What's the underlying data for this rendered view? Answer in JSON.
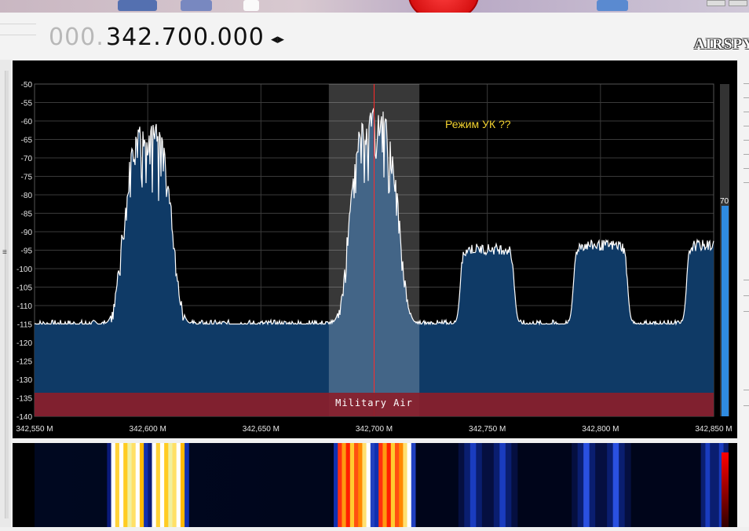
{
  "frequency": {
    "dim_prefix": "000.",
    "main": "342.700.000",
    "step_arrows": "◂▸"
  },
  "brand": {
    "logo_text": "AIRSPY"
  },
  "colors": {
    "spectrum_fill": "#0f3a66",
    "spectrum_line": "#ffffff",
    "band_plan": "#8a1e2a",
    "filter_overlay": "#ffffff",
    "center_line": "#ff2a2a",
    "annotation": "#f2d230",
    "signal_meter": "#2f8be0"
  },
  "chart_data": {
    "type": "area",
    "title": "",
    "xlabel": "",
    "ylabel": "",
    "x_range": [
      342550000,
      342850000
    ],
    "ylim": [
      -140,
      -50
    ],
    "grid": true,
    "y_ticks": [
      "-50",
      "-55",
      "-60",
      "-65",
      "-70",
      "-75",
      "-80",
      "-85",
      "-90",
      "-95",
      "-100",
      "-105",
      "-110",
      "-115",
      "-120",
      "-125",
      "-130",
      "-135",
      "-140"
    ],
    "x_ticks": [
      "342,550 M",
      "342,600 M",
      "342,650 M",
      "342,700 M",
      "342,750 M",
      "342,800 M",
      "342,850 M"
    ],
    "noise_floor_db": -115,
    "signals": [
      {
        "center_hz": 342600000,
        "peak_db": -60,
        "bandwidth_hz": 34000
      },
      {
        "center_hz": 342700000,
        "peak_db": -56,
        "bandwidth_hz": 34000
      },
      {
        "center_hz": 342750000,
        "peak_db": -93,
        "bandwidth_hz": 24000
      },
      {
        "center_hz": 342800000,
        "peak_db": -92,
        "bandwidth_hz": 24000
      },
      {
        "center_hz": 342850000,
        "peak_db": -92,
        "bandwidth_hz": 24000
      }
    ],
    "tuned_frequency_hz": 342700000,
    "filter_low_hz": 342680000,
    "filter_high_hz": 342720000
  },
  "band_plan": {
    "label": "Military Air",
    "start_hz": 342550000,
    "end_hz": 342850000
  },
  "annotation": {
    "text": "Режим УК ??"
  },
  "signal_meter": {
    "value_label": "70",
    "level": 0.7
  }
}
